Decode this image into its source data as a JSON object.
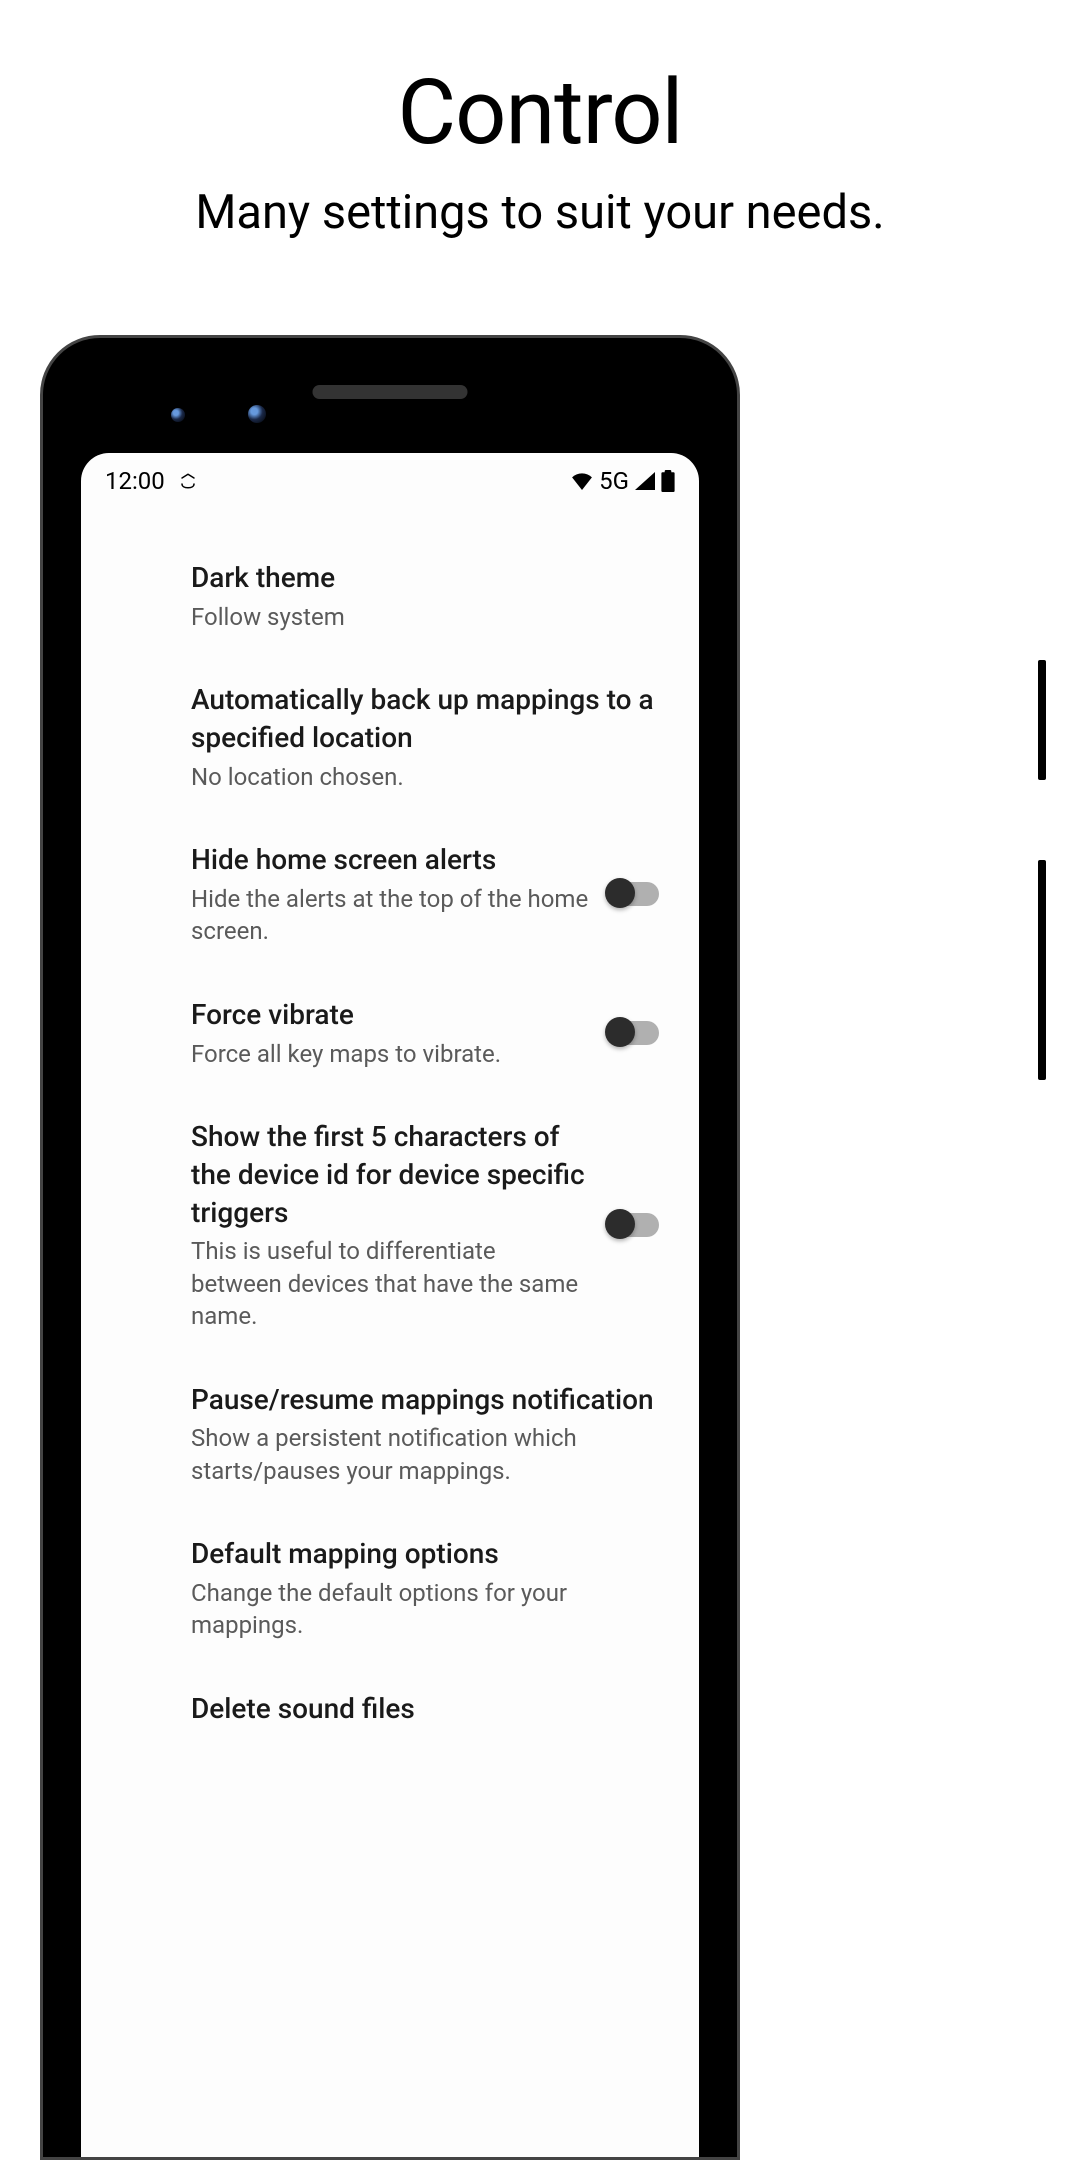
{
  "header": {
    "title": "Control",
    "subtitle": "Many settings to suit your needs."
  },
  "statusBar": {
    "time": "12:00",
    "network": "5G"
  },
  "settings": {
    "darkTheme": {
      "title": "Dark theme",
      "subtitle": "Follow system"
    },
    "backup": {
      "title": "Automatically back up mappings to a specified location",
      "subtitle": "No location chosen."
    },
    "hideAlerts": {
      "title": "Hide home screen alerts",
      "subtitle": "Hide the alerts at the top of the home screen."
    },
    "forceVibrate": {
      "title": "Force vibrate",
      "subtitle": "Force all key maps to vibrate."
    },
    "deviceId": {
      "title": "Show the first 5 characters of the device id for device specific triggers",
      "subtitle": "This is useful to differentiate between devices that have the same name."
    },
    "notification": {
      "title": "Pause/resume mappings notification",
      "subtitle": "Show a persistent notification which starts/pauses your mappings."
    },
    "defaultOptions": {
      "title": "Default mapping options",
      "subtitle": "Change the default options for your mappings."
    },
    "deleteSound": {
      "title": "Delete sound files"
    }
  }
}
